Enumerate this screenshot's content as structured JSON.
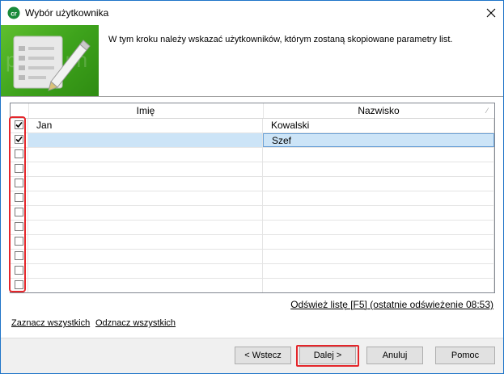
{
  "window": {
    "title": "Wybór użytkownika",
    "icon": "app-logo-icon",
    "close_icon": "close-icon"
  },
  "header": {
    "instruction": "W tym kroku należy wskazać użytkowników, którym zostaną skopiowane parametry list.",
    "banner_icon": "document-edit-icon",
    "watermark": "premium"
  },
  "grid": {
    "columns": [
      {
        "key": "checked",
        "label": ""
      },
      {
        "key": "imie",
        "label": "Imię"
      },
      {
        "key": "nazwisko",
        "label": "Nazwisko"
      }
    ],
    "rows": [
      {
        "checked": true,
        "imie": "Jan",
        "nazwisko": "Kowalski",
        "selected": false
      },
      {
        "checked": true,
        "imie": "",
        "nazwisko": "Szef",
        "selected": true
      },
      {
        "checked": false,
        "imie": "",
        "nazwisko": "",
        "selected": false
      },
      {
        "checked": false,
        "imie": "",
        "nazwisko": "",
        "selected": false
      },
      {
        "checked": false,
        "imie": "",
        "nazwisko": "",
        "selected": false
      },
      {
        "checked": false,
        "imie": "",
        "nazwisko": "",
        "selected": false
      },
      {
        "checked": false,
        "imie": "",
        "nazwisko": "",
        "selected": false
      },
      {
        "checked": false,
        "imie": "",
        "nazwisko": "",
        "selected": false
      },
      {
        "checked": false,
        "imie": "",
        "nazwisko": "",
        "selected": false
      },
      {
        "checked": false,
        "imie": "",
        "nazwisko": "",
        "selected": false
      },
      {
        "checked": false,
        "imie": "",
        "nazwisko": "",
        "selected": false
      },
      {
        "checked": false,
        "imie": "",
        "nazwisko": "",
        "selected": false
      }
    ],
    "highlight_color": "#cce4f7",
    "annotation_color": "#e4262b"
  },
  "refresh": {
    "link_label": "Odśwież listę [F5]",
    "last_refresh": "(ostatnie odświeżenie 08:53)"
  },
  "links": {
    "select_all": "Zaznacz wszystkich",
    "deselect_all": "Odznacz wszystkich"
  },
  "buttons": {
    "back": "< Wstecz",
    "next": "Dalej >",
    "cancel": "Anuluj",
    "help": "Pomoc"
  }
}
